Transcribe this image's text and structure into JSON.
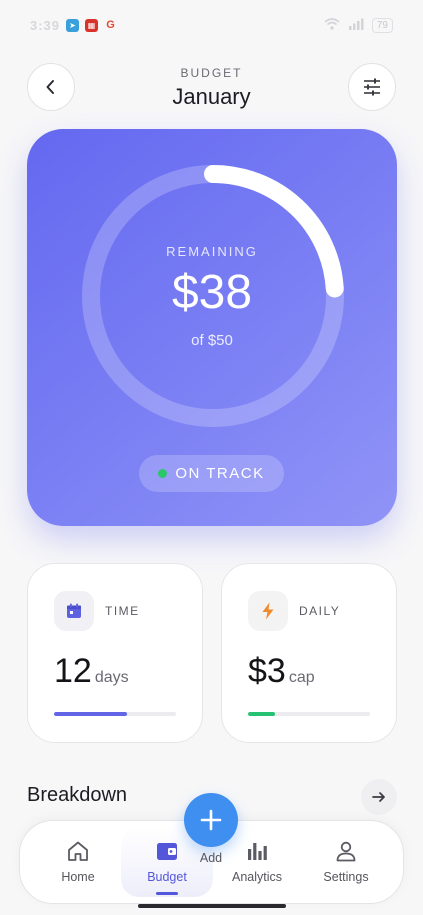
{
  "status_bar": {
    "time": "3:39",
    "battery": "79",
    "notification_icons": [
      "telegram-icon",
      "calendar-icon",
      "google-icon"
    ]
  },
  "header": {
    "label": "BUDGET",
    "title": "January",
    "back_icon": "chevron-left-icon",
    "filter_icon": "sliders-icon"
  },
  "hero": {
    "remaining_label": "REMAINING",
    "remaining_value": "$38",
    "of_total": "of $50",
    "status": "ON TRACK",
    "progress_fraction": 0.24,
    "gradient_start": "#6468f0",
    "gradient_end": "#9094f7",
    "status_dot_color": "#2cc56b"
  },
  "stats": [
    {
      "label": "TIME",
      "value": "12",
      "unit": "days",
      "progress": 0.6,
      "icon": "calendar-icon",
      "accent": "#6265e6"
    },
    {
      "label": "DAILY",
      "value": "$3",
      "unit": "cap",
      "progress": 0.22,
      "icon": "lightning-icon",
      "accent": "#27c172"
    }
  ],
  "breakdown": {
    "title": "Breakdown",
    "arrow_icon": "arrow-right-icon"
  },
  "nav": {
    "home": "Home",
    "budget": "Budget",
    "add": "Add",
    "analytics": "Analytics",
    "settings": "Settings",
    "active": "budget",
    "accent": "#5356d8",
    "fab_color": "#3f8ff0"
  }
}
